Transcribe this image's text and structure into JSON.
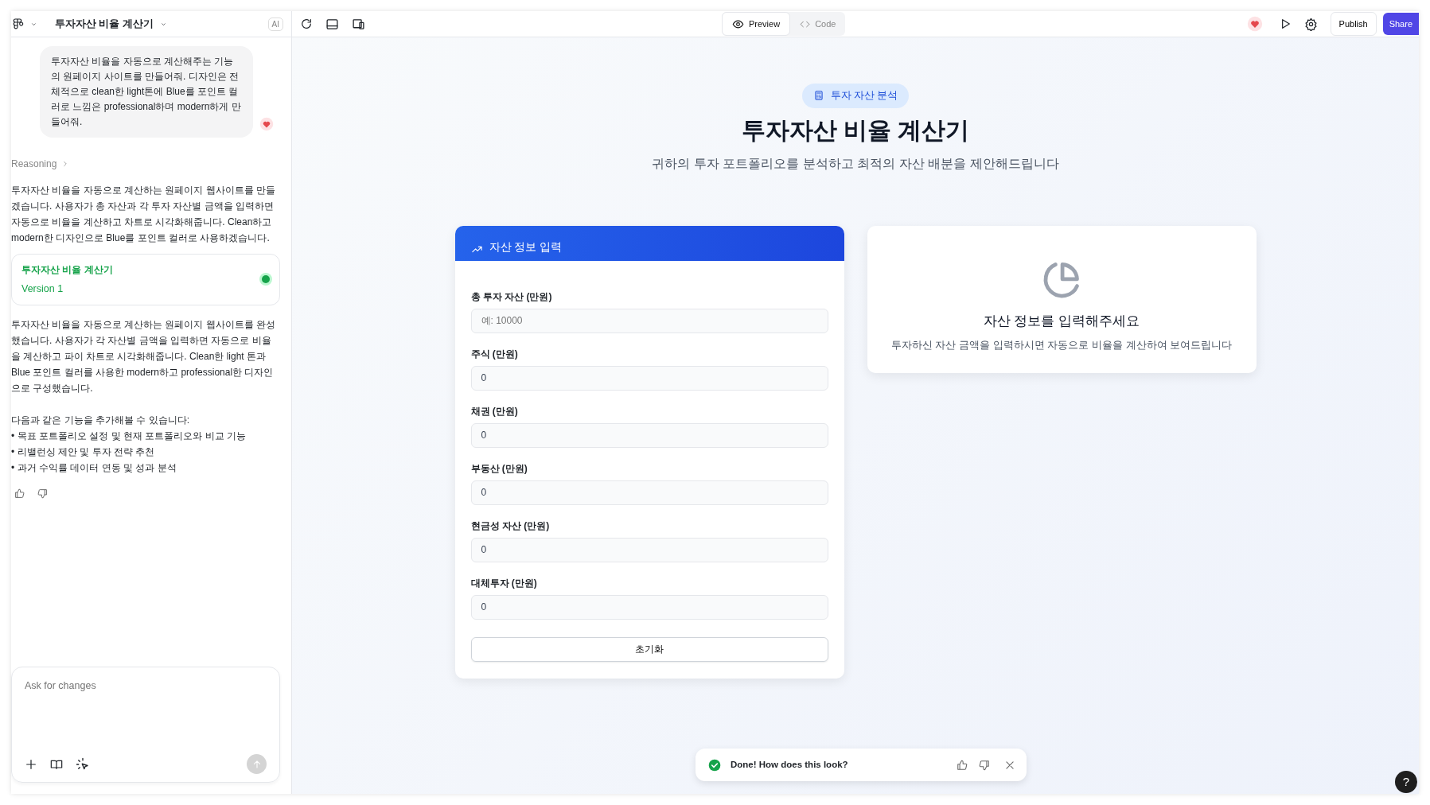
{
  "header": {
    "project_title": "투자자산 비율 계산기",
    "ai_badge": "AI"
  },
  "chat": {
    "user_message": "투자자산 비율을 자동으로 계산해주는 기능의 원페이지 사이트를 만들어줘. 디자인은 전체적으로 clean한 light톤에 Blue를 포인트 컬러로 느낌은 professional하며 modern하게 만들어줘.",
    "reasoning_label": "Reasoning",
    "intro": "투자자산 비율을 자동으로 계산하는 원페이지 웹사이트를 만들겠습니다. 사용자가 총 자산과 각 투자 자산별 금액을 입력하면 자동으로 비율을 계산하고 차트로 시각화해줍니다. Clean하고 modern한 디자인으로 Blue를 포인트 컬러로 사용하겠습니다.",
    "artifact": {
      "title": "투자자산 비율 계산기",
      "version": "Version 1"
    },
    "summary": "투자자산 비율을 자동으로 계산하는 원페이지 웹사이트를 완성했습니다. 사용자가 각 자산별 금액을 입력하면 자동으로 비율을 계산하고 파이 차트로 시각화해줍니다. Clean한 light 톤과 Blue 포인트 컬러를 사용한 modern하고 professional한 디자인으로 구성했습니다.",
    "followup_intro": "다음과 같은 기능을 추가해볼 수 있습니다:",
    "followup_items": [
      "• 목표 포트폴리오 설정 및 현재 포트폴리오와 비교 기능",
      "• 리밸런싱 제안 및 투자 전략 추천",
      "• 과거 수익률 데이터 연동 및 성과 분석"
    ]
  },
  "composer": {
    "placeholder": "Ask for changes"
  },
  "toolbar": {
    "view_tabs": [
      {
        "label": "Preview",
        "selected": true
      },
      {
        "label": "Code",
        "selected": false
      }
    ],
    "publish": "Publish",
    "share": "Share"
  },
  "preview": {
    "badge": "투자 자산 분석",
    "title": "투자자산 비율 계산기",
    "subtitle": "귀하의 투자 포트폴리오를 분석하고 최적의 자산 배분을 제안해드립니다",
    "form": {
      "title": "자산 정보 입력",
      "fields": [
        {
          "label": "총 투자 자산 (만원)",
          "placeholder": "예: 10000"
        },
        {
          "label": "주식 (만원)",
          "value": "0"
        },
        {
          "label": "채권 (만원)",
          "value": "0"
        },
        {
          "label": "부동산 (만원)",
          "value": "0"
        },
        {
          "label": "현금성 자산 (만원)",
          "value": "0"
        },
        {
          "label": "대체투자 (만원)",
          "value": "0"
        }
      ],
      "reset": "초기화"
    },
    "empty_state": {
      "title": "자산 정보를 입력해주세요",
      "text": "투자하신 자산 금액을 입력하시면 자동으로 비율을 계산하여 보여드립니다"
    }
  },
  "toast": {
    "text": "Done! How does this look?"
  },
  "help": "?"
}
